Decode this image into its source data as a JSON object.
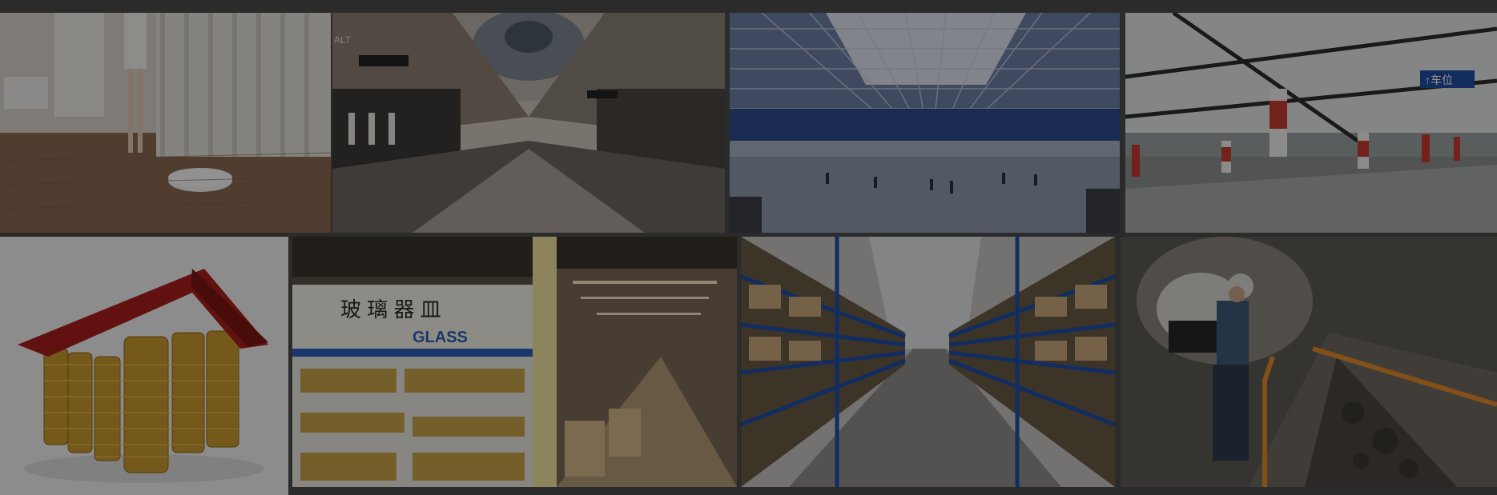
{
  "tiles": [
    {
      "name": "robot-vacuum-home-tile",
      "texts": []
    },
    {
      "name": "shopping-mall-interior-tile",
      "texts": [
        "ALT"
      ]
    },
    {
      "name": "exhibition-hall-tile",
      "texts": []
    },
    {
      "name": "underground-parking-tile",
      "texts": [
        "↑车位"
      ]
    },
    {
      "name": "coin-house-tile",
      "texts": []
    },
    {
      "name": "supermarket-aisle-tile",
      "texts": [
        "玻 璃 器 皿",
        "GLASS"
      ]
    },
    {
      "name": "warehouse-shelves-tile",
      "texts": []
    },
    {
      "name": "mine-tunnel-tile",
      "texts": []
    }
  ],
  "colors": {
    "background": "#4a4a4a",
    "overlay": "rgba(0,0,0,0.42)"
  }
}
